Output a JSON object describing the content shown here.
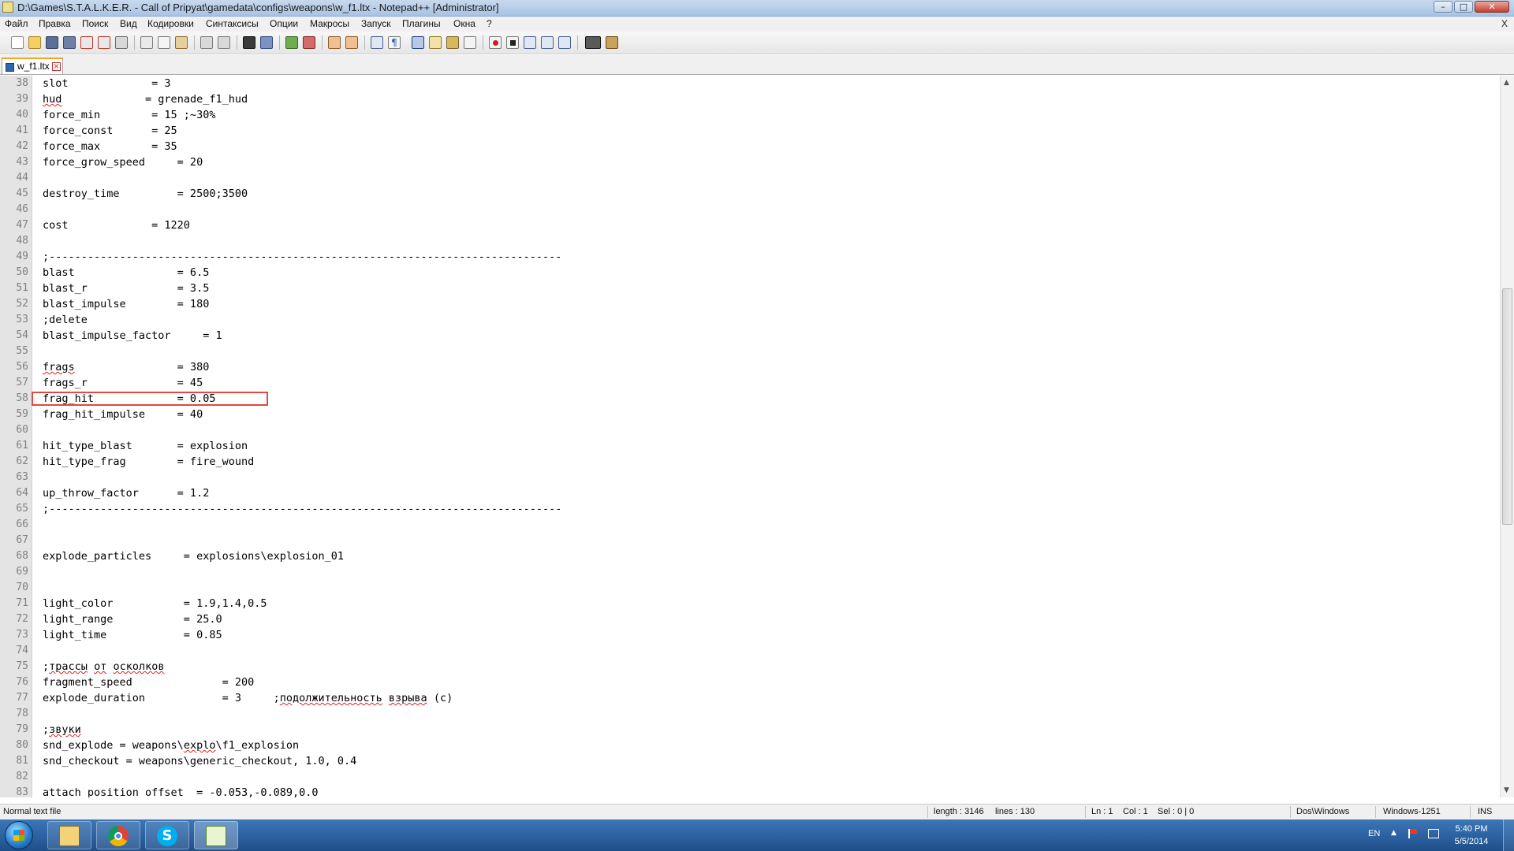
{
  "window": {
    "title": "D:\\Games\\S.T.A.L.K.E.R. - Call of Pripyat\\gamedata\\configs\\weapons\\w_f1.ltx - Notepad++ [Administrator]",
    "menu_close": "X"
  },
  "menu": [
    "Файл",
    "Правка",
    "Поиск",
    "Вид",
    "Кодировки",
    "Синтаксисы",
    "Опции",
    "Макросы",
    "Запуск",
    "Плагины",
    "Окна",
    "?"
  ],
  "toolbar_icons": [
    "new-file-icon",
    "open-file-icon",
    "save-icon",
    "save-all-icon",
    "close-icon",
    "close-all-icon",
    "print-icon",
    "cut-icon",
    "copy-icon",
    "paste-icon",
    "undo-icon",
    "redo-icon",
    "find-icon",
    "replace-icon",
    "zoom-in-icon",
    "zoom-out-icon",
    "sync-v-icon",
    "sync-h-icon",
    "word-wrap-icon",
    "show-all-chars-icon",
    "indent-guide-icon",
    "lang-udl-icon",
    "doc-map-icon",
    "function-list-icon",
    "monitoring-icon",
    "record-macro-icon",
    "stop-record-icon",
    "play-macro-icon",
    "run-macro-multiple-icon",
    "save-macro-icon",
    "spellcheck-icon",
    "clipboard-history-icon"
  ],
  "tab": {
    "name": "w_f1.ltx"
  },
  "editor": {
    "highlighted_line": "58",
    "lines": [
      {
        "n": "38",
        "text": "slot             = 3"
      },
      {
        "n": "39",
        "text": "hud             = grenade_f1_hud"
      },
      {
        "n": "40",
        "text": "force_min        = 15 ;~30%"
      },
      {
        "n": "41",
        "text": "force_const      = 25"
      },
      {
        "n": "42",
        "text": "force_max        = 35"
      },
      {
        "n": "43",
        "text": "force_grow_speed     = 20"
      },
      {
        "n": "44",
        "text": ""
      },
      {
        "n": "45",
        "text": "destroy_time         = 2500;3500"
      },
      {
        "n": "46",
        "text": ""
      },
      {
        "n": "47",
        "text": "cost             = 1220"
      },
      {
        "n": "48",
        "text": ""
      },
      {
        "n": "49",
        "text": ";--------------------------------------------------------------------------------"
      },
      {
        "n": "50",
        "text": "blast                = 6.5"
      },
      {
        "n": "51",
        "text": "blast_r              = 3.5"
      },
      {
        "n": "52",
        "text": "blast_impulse        = 180"
      },
      {
        "n": "53",
        "text": ";delete"
      },
      {
        "n": "54",
        "text": "blast_impulse_factor     = 1"
      },
      {
        "n": "55",
        "text": ""
      },
      {
        "n": "56",
        "text": "frags                = 380"
      },
      {
        "n": "57",
        "text": "frags_r              = 45"
      },
      {
        "n": "58",
        "text": "frag_hit             = 0.05"
      },
      {
        "n": "59",
        "text": "frag_hit_impulse     = 40"
      },
      {
        "n": "60",
        "text": ""
      },
      {
        "n": "61",
        "text": "hit_type_blast       = explosion"
      },
      {
        "n": "62",
        "text": "hit_type_frag        = fire_wound"
      },
      {
        "n": "63",
        "text": ""
      },
      {
        "n": "64",
        "text": "up_throw_factor      = 1.2"
      },
      {
        "n": "65",
        "text": ";--------------------------------------------------------------------------------"
      },
      {
        "n": "66",
        "text": ""
      },
      {
        "n": "67",
        "text": ""
      },
      {
        "n": "68",
        "text": "explode_particles     = explosions\\explosion_01"
      },
      {
        "n": "69",
        "text": ""
      },
      {
        "n": "70",
        "text": ""
      },
      {
        "n": "71",
        "text": "light_color           = 1.9,1.4,0.5"
      },
      {
        "n": "72",
        "text": "light_range           = 25.0"
      },
      {
        "n": "73",
        "text": "light_time            = 0.85"
      },
      {
        "n": "74",
        "text": ""
      },
      {
        "n": "75",
        "text": ";трассы от осколков"
      },
      {
        "n": "76",
        "text": "fragment_speed              = 200"
      },
      {
        "n": "77",
        "text": "explode_duration            = 3     ;подолжительность взрыва (с)"
      },
      {
        "n": "78",
        "text": ""
      },
      {
        "n": "79",
        "text": ";звуки"
      },
      {
        "n": "80",
        "text": "snd_explode = weapons\\explo\\f1_explosion"
      },
      {
        "n": "81",
        "text": "snd_checkout = weapons\\generic_checkout, 1.0, 0.4"
      },
      {
        "n": "82",
        "text": ""
      },
      {
        "n": "83",
        "text": "attach_position_offset  = -0.053,-0.089,0.0"
      }
    ]
  },
  "statusbar": {
    "file_type": "Normal text file",
    "length": "length : 3146",
    "lines": "lines : 130",
    "ln": "Ln : 1",
    "col": "Col : 1",
    "sel": "Sel : 0 | 0",
    "eol": "Dos\\Windows",
    "encoding": "Windows-1251",
    "mode": "INS"
  },
  "taskbar": {
    "apps": [
      "explorer-icon",
      "chrome-icon",
      "skype-icon",
      "notepadpp-icon"
    ],
    "lang": "EN",
    "time": "5:40 PM",
    "date": "5/5/2014"
  },
  "colors": {
    "highlight_box": "#e2493f",
    "gutter_bg": "#e4e4e4",
    "taskbar": "#2a5f9e"
  }
}
